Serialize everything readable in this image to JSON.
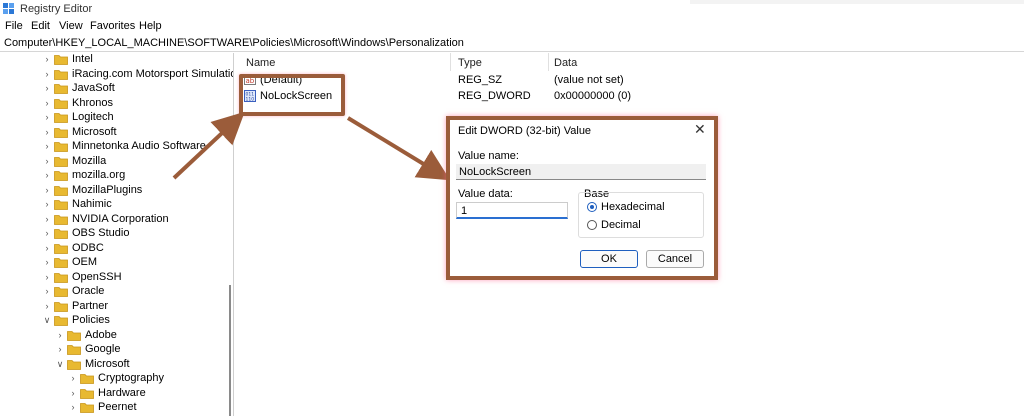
{
  "window": {
    "title": "Registry Editor"
  },
  "menu": [
    "File",
    "Edit",
    "View",
    "Favorites",
    "Help"
  ],
  "address": "Computer\\HKEY_LOCAL_MACHINE\\SOFTWARE\\Policies\\Microsoft\\Windows\\Personalization",
  "tree": [
    {
      "label": "Intel",
      "expanded": false
    },
    {
      "label": "iRacing.com Motorsport Simulation",
      "expanded": false
    },
    {
      "label": "JavaSoft",
      "expanded": false
    },
    {
      "label": "Khronos",
      "expanded": false
    },
    {
      "label": "Logitech",
      "expanded": false
    },
    {
      "label": "Microsoft",
      "expanded": false
    },
    {
      "label": "Minnetonka Audio Software",
      "expanded": false
    },
    {
      "label": "Mozilla",
      "expanded": false
    },
    {
      "label": "mozilla.org",
      "expanded": false
    },
    {
      "label": "MozillaPlugins",
      "expanded": false
    },
    {
      "label": "Nahimic",
      "expanded": false
    },
    {
      "label": "NVIDIA Corporation",
      "expanded": false
    },
    {
      "label": "OBS Studio",
      "expanded": false
    },
    {
      "label": "ODBC",
      "expanded": false
    },
    {
      "label": "OEM",
      "expanded": false
    },
    {
      "label": "OpenSSH",
      "expanded": false
    },
    {
      "label": "Oracle",
      "expanded": false
    },
    {
      "label": "Partner",
      "expanded": false
    },
    {
      "label": "Policies",
      "expanded": true
    },
    {
      "label": "Adobe",
      "expanded": false
    },
    {
      "label": "Google",
      "expanded": false
    },
    {
      "label": "Microsoft",
      "expanded": true
    },
    {
      "label": "Cryptography",
      "expanded": false
    },
    {
      "label": "Hardware",
      "expanded": false
    },
    {
      "label": "Peernet",
      "expanded": false
    }
  ],
  "list": {
    "headers": [
      "Name",
      "Type",
      "Data"
    ],
    "rows": [
      {
        "name": "(Default)",
        "type": "REG_SZ",
        "data": "(value not set)",
        "icon": "string-value-icon"
      },
      {
        "name": "NoLockScreen",
        "type": "REG_DWORD",
        "data": "0x00000000 (0)",
        "icon": "dword-value-icon"
      }
    ]
  },
  "dialog": {
    "title": "Edit DWORD (32-bit) Value",
    "value_name_label": "Value name:",
    "value_name": "NoLockScreen",
    "value_data_label": "Value data:",
    "value_data": "1",
    "base_label": "Base",
    "base_options": [
      "Hexadecimal",
      "Decimal"
    ],
    "base_selected": "Hexadecimal",
    "ok_label": "OK",
    "cancel_label": "Cancel"
  },
  "colors": {
    "annotation": "#9b5c3a",
    "folder": "#e8b931",
    "accent": "#1f5fbf"
  }
}
